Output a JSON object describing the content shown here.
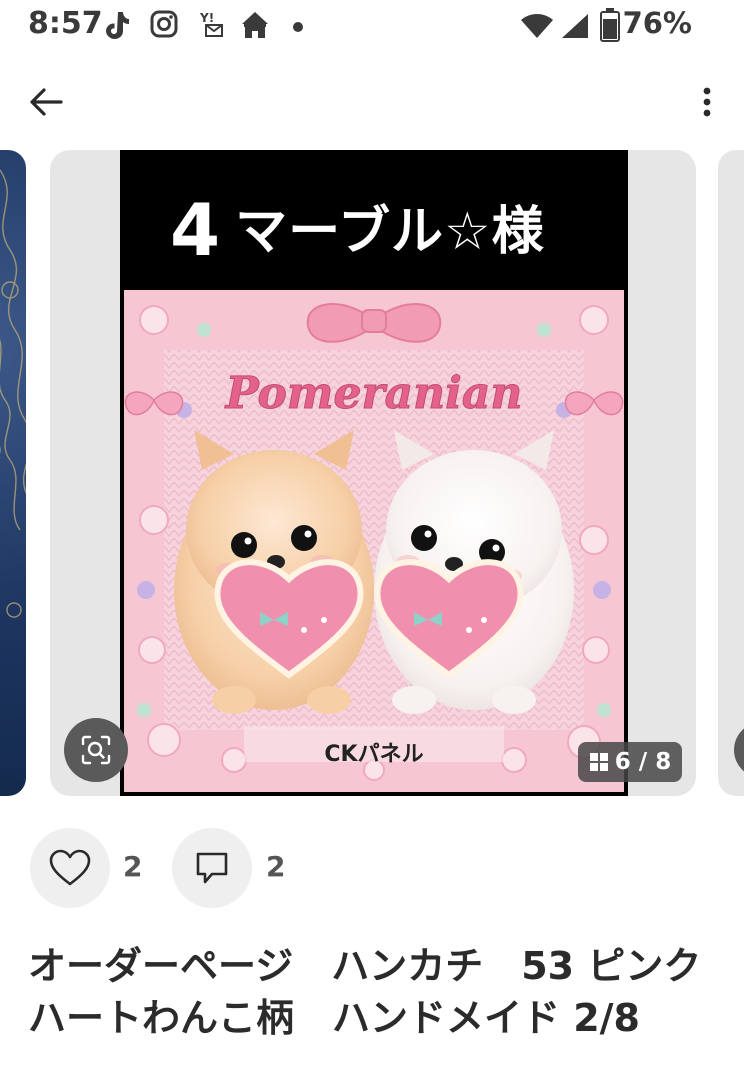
{
  "status_bar": {
    "time": "8:57",
    "battery_percent": "76%",
    "battery_level": 0.76,
    "icons": [
      "tiktok-icon",
      "instagram-icon",
      "yahoo-mail-icon",
      "circus-tent-icon",
      "dot-icon",
      "wifi-icon",
      "signal-icon",
      "battery-icon"
    ]
  },
  "nav": {
    "back_icon": "arrow-left-icon",
    "more_icon": "more-vertical-icon"
  },
  "listing": {
    "image_header": {
      "number": "4",
      "text": "マーブル☆様"
    },
    "image_art_title": "Pomeranian",
    "image_caption": "CKパネル",
    "image_counter": "6 / 8",
    "likes": "2",
    "comments": "2",
    "title": "オーダーページ　ハンカチ　53 ピンクハートわんこ柄　ハンドメイド 2/8"
  },
  "colors": {
    "header_bg": "#000000",
    "card_bg": "#e6e6e6",
    "pink": "#f2a6bd",
    "knit_pink": "#f7d2dc",
    "title_text": "#2b2b2b"
  }
}
